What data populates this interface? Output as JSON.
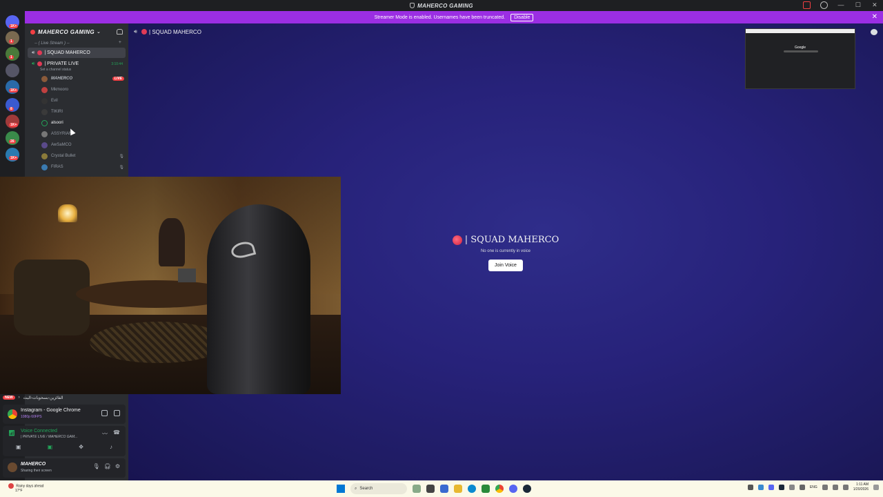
{
  "window": {
    "title": "MAHERCO GAMING",
    "controls": [
      "—",
      "☐",
      "✕"
    ]
  },
  "banner": {
    "text": "Streamer Mode is enabled. Usernames have been truncated.",
    "button": "Disable"
  },
  "rail": {
    "badges": [
      "1K+",
      "1",
      "1",
      "1K+",
      "8",
      "1K+",
      "26",
      "1K+"
    ]
  },
  "server": {
    "name": "MAHERCO GAMING"
  },
  "category": {
    "label": "-- ( Live Stream ) -- "
  },
  "channels": {
    "squad": {
      "name": "| SQUAD MAHERCO"
    },
    "private": {
      "name": "| PRIVATE LIVE",
      "timer": "3:10:44",
      "status_hint": "Set a channel status"
    }
  },
  "voice_users": [
    {
      "name": "MAHERCO",
      "live": "LIVE"
    },
    {
      "name": "Mkmooro"
    },
    {
      "name": "Evil"
    },
    {
      "name": "TIKIRI"
    },
    {
      "name": "alsoori"
    },
    {
      "name": "ASSYRIAN"
    },
    {
      "name": "AwSaMCO"
    },
    {
      "name": "Crystal Bullet"
    },
    {
      "name": "FIRAS"
    }
  ],
  "main": {
    "header": "| SQUAD MAHERCO",
    "center_title": "| SQUAD MAHERCO",
    "center_sub": "No one is currently in voice",
    "join_button": "Join Voice",
    "preview_label": "Google"
  },
  "new_row": {
    "badge": "NEW",
    "text": "الفائزين-بسحوبات-البث"
  },
  "stream_panel": {
    "title": "Instagram - Google Chrome",
    "sub": "1080p 60FPS"
  },
  "voice_panel": {
    "status": "Voice Connected",
    "channel": "| PRIVATE LIVE / MAHERCO GAM..."
  },
  "user_panel": {
    "name": "MAHERCO",
    "status": "Sharing their screen"
  },
  "taskbar": {
    "weather_line1": "Rainy days ahead",
    "weather_line2": "17°F",
    "search": "Search",
    "lang": "ENG",
    "time": "1:11 AM",
    "date": "1/20/2026"
  }
}
